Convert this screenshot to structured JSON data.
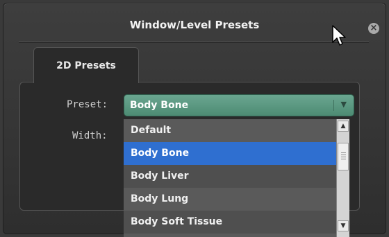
{
  "dialog": {
    "title": "Window/Level Presets",
    "close_icon": "close-icon"
  },
  "tabs": [
    {
      "label": "2D Presets",
      "active": true
    }
  ],
  "form": {
    "preset_label": "Preset:",
    "width_label": "Width:",
    "preset_value": "Body Bone"
  },
  "dropdown": {
    "options": [
      "Default",
      "Body Bone",
      "Body Liver",
      "Body Lung",
      "Body Soft Tissue"
    ],
    "selected": "Body Bone"
  },
  "colors": {
    "select_accent": "#5a9a82",
    "highlight": "#2f6fd0",
    "background": "#333333"
  }
}
